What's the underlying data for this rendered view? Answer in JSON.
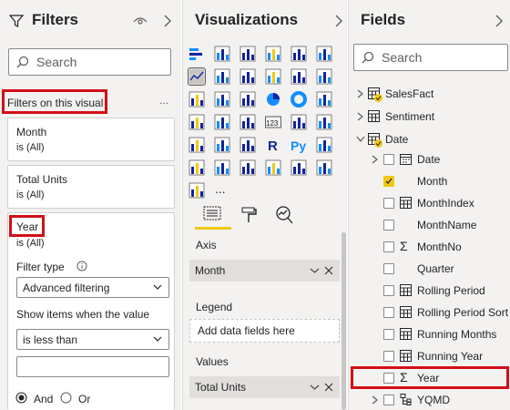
{
  "filters": {
    "title": "Filters",
    "search_placeholder": "Search",
    "section_label": "Filters on this visual",
    "more": "...",
    "cards": [
      {
        "title": "Month",
        "value": "is (All)"
      },
      {
        "title": "Total Units",
        "value": "is (All)"
      },
      {
        "title": "Year",
        "value": "is (All)"
      }
    ],
    "filter_type_label": "Filter type",
    "filter_type_value": "Advanced filtering",
    "show_items_label": "Show items when the value",
    "condition_value": "is less than",
    "condition_input": "",
    "and_label": "And",
    "or_label": "Or"
  },
  "viz": {
    "title": "Visualizations",
    "axis_label": "Axis",
    "axis_field": "Month",
    "legend_label": "Legend",
    "legend_placeholder": "Add data fields here",
    "values_label": "Values",
    "values_field": "Total Units",
    "more": "...",
    "py_label": "Py",
    "r_label": "R",
    "num_label": "123"
  },
  "fields": {
    "title": "Fields",
    "search_placeholder": "Search",
    "tables": [
      {
        "label": "SalesFact"
      },
      {
        "label": "Sentiment"
      },
      {
        "label": "Date"
      }
    ],
    "items": [
      {
        "label": "Date",
        "icon": "calendar-icon",
        "checked": false
      },
      {
        "label": "Month",
        "icon": "none",
        "checked": true
      },
      {
        "label": "MonthIndex",
        "icon": "hierarchy-table-icon",
        "checked": false
      },
      {
        "label": "MonthName",
        "icon": "none",
        "checked": false
      },
      {
        "label": "MonthNo",
        "icon": "sigma-icon",
        "checked": false
      },
      {
        "label": "Quarter",
        "icon": "none",
        "checked": false
      },
      {
        "label": "Rolling Period",
        "icon": "calc-table-icon",
        "checked": false
      },
      {
        "label": "Rolling Period Sort",
        "icon": "table-icon",
        "checked": false
      },
      {
        "label": "Running Months",
        "icon": "table-icon",
        "checked": false
      },
      {
        "label": "Running Year",
        "icon": "table-icon",
        "checked": false
      },
      {
        "label": "Year",
        "icon": "sigma-icon",
        "checked": false
      },
      {
        "label": "YQMD",
        "icon": "hierarchy-icon",
        "checked": false
      }
    ]
  },
  "colors": {
    "accent": "#f2c811",
    "highlight": "#d20f17",
    "chart_blue": "#118dff",
    "chart_dark": "#12239e"
  }
}
